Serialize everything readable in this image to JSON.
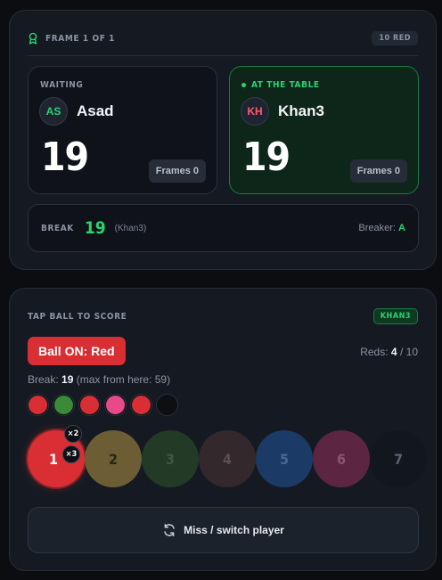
{
  "frame": {
    "label": "FRAME 1 OF 1",
    "reds_badge": "10 RED"
  },
  "players": [
    {
      "status": "WAITING",
      "initials": "AS",
      "name": "Asad",
      "score": "19",
      "frames_label": "Frames",
      "frames_value": "0"
    },
    {
      "status": "AT THE TABLE",
      "initials": "KH",
      "name": "Khan3",
      "score": "19",
      "frames_label": "Frames",
      "frames_value": "0"
    }
  ],
  "break_bar": {
    "label": "BREAK",
    "value": "19",
    "player": "(Khan3)",
    "breaker_label": "Breaker:",
    "breaker_value": "A"
  },
  "scoring": {
    "title": "TAP BALL TO SCORE",
    "current_player_badge": "KHAN3",
    "ball_on": "Ball ON: Red",
    "reds_label": "Reds:",
    "reds_remaining": "4",
    "reds_sep": "/",
    "reds_total": "10",
    "break_label": "Break:",
    "break_value": "19",
    "break_max": "(max from here: 59)",
    "sequence_colors": [
      "#d92f34",
      "#3a8a37",
      "#d92f34",
      "#e94a86",
      "#d92f34",
      "#0d0f13"
    ],
    "balls": [
      {
        "label": "1",
        "color": "#d92f34",
        "text_color": "#ffffff",
        "active": true
      },
      {
        "label": "2",
        "color": "#6c5d34",
        "text_color": "#2a2410",
        "active": false
      },
      {
        "label": "3",
        "color": "#233a27",
        "text_color": "#3c5a40",
        "active": false
      },
      {
        "label": "4",
        "color": "#33292c",
        "text_color": "#5e4e52",
        "active": false
      },
      {
        "label": "5",
        "color": "#1c3a66",
        "text_color": "#4a6894",
        "active": false
      },
      {
        "label": "6",
        "color": "#5c2542",
        "text_color": "#8a5470",
        "active": false
      },
      {
        "label": "7",
        "color": "#12161d",
        "text_color": "#5a6270",
        "active": false
      }
    ],
    "multipliers": [
      "×2",
      "×3"
    ],
    "miss_button": "Miss / switch player"
  },
  "colors": {
    "accent_green": "#2bd36d",
    "red": "#d92f34",
    "card_bg": "#151a22"
  }
}
